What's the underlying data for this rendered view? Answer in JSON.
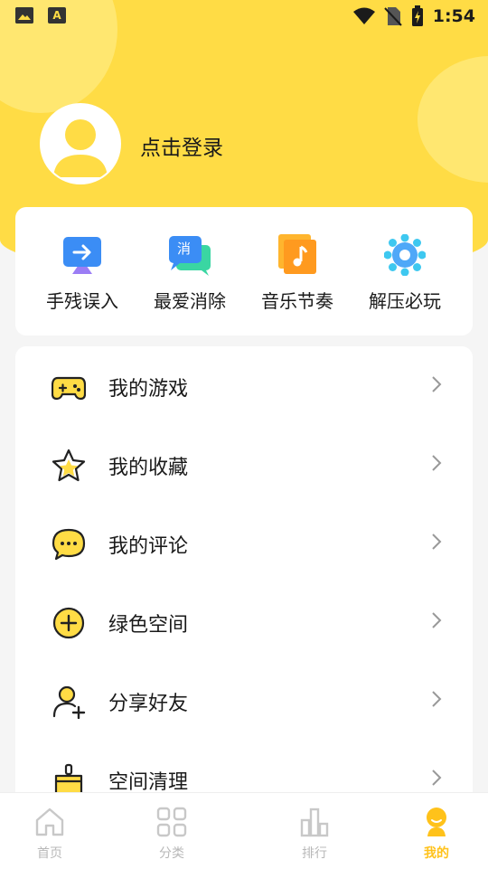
{
  "status_bar": {
    "time": "1:54"
  },
  "profile": {
    "login_label": "点击登录"
  },
  "quick_actions": [
    {
      "label": "手残误入",
      "icon": "arrow-screen-icon"
    },
    {
      "label": "最爱消除",
      "icon": "chat-bubbles-icon",
      "icon_text": "消"
    },
    {
      "label": "音乐节奏",
      "icon": "music-note-icon"
    },
    {
      "label": "解压必玩",
      "icon": "dotted-circle-icon"
    }
  ],
  "menu": [
    {
      "label": "我的游戏",
      "icon": "gamepad-icon"
    },
    {
      "label": "我的收藏",
      "icon": "star-icon"
    },
    {
      "label": "我的评论",
      "icon": "comment-icon"
    },
    {
      "label": "绿色空间",
      "icon": "plus-circle-icon"
    },
    {
      "label": "分享好友",
      "icon": "add-user-icon"
    },
    {
      "label": "空间清理",
      "icon": "broom-icon"
    }
  ],
  "bottom_nav": [
    {
      "label": "首页",
      "icon": "home-icon"
    },
    {
      "label": "分类",
      "icon": "grid-icon"
    },
    {
      "label": "排行",
      "icon": "ranking-icon"
    },
    {
      "label": "我的",
      "icon": "profile-icon",
      "active": true
    }
  ],
  "colors": {
    "accent": "#ffdc45",
    "active_nav": "#ffc21a"
  }
}
